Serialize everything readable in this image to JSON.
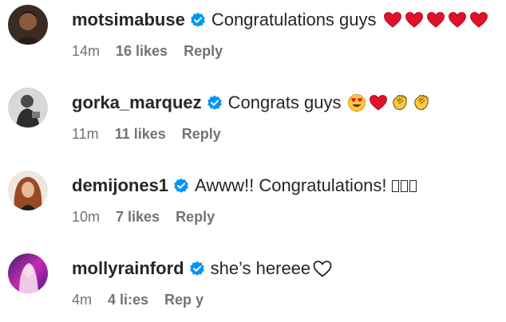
{
  "comments": [
    {
      "username": "motsimabuse",
      "text": "Congratulations guys",
      "emojis": [
        "red-heart",
        "red-heart",
        "red-heart",
        "red-heart",
        "red-heart"
      ],
      "time": "14m",
      "likes": "16 likes",
      "reply": "Reply"
    },
    {
      "username": "gorka_marquez",
      "text": "Congrats guys",
      "emojis": [
        "heart-eyes-face",
        "red-heart",
        "clapping-hands",
        "clapping-hands"
      ],
      "time": "11m",
      "likes": "11 likes",
      "reply": "Reply"
    },
    {
      "username": "demijones1",
      "text": "Awww!! Congratulations!",
      "emojis": [
        "missing-glyph",
        "missing-glyph",
        "missing-glyph"
      ],
      "time": "10m",
      "likes": "7 likes",
      "reply": "Reply"
    },
    {
      "username": "mollyrainford",
      "text": "she’s hereee",
      "emojis": [
        "white-heart-outline"
      ],
      "time": "4m",
      "likes": "4 li:es",
      "reply": "Rep y"
    }
  ],
  "colors": {
    "text": "#262626",
    "meta": "#737373",
    "verified": "#0095f6",
    "heart": "#e0112b"
  }
}
